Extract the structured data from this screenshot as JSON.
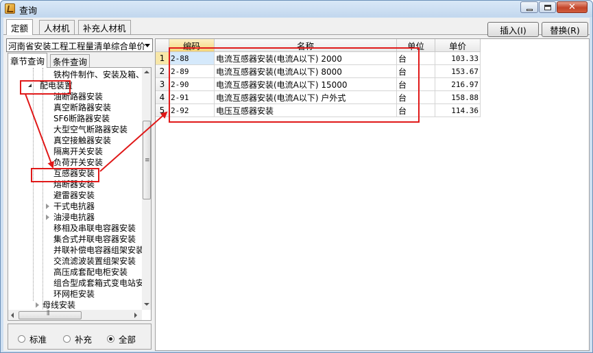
{
  "window": {
    "title": "查询"
  },
  "tabs": [
    {
      "label": "定额"
    },
    {
      "label": "人材机"
    },
    {
      "label": "补充人材机"
    }
  ],
  "toolbar": {
    "insert_label": "插入(I)",
    "replace_label": "替换(R)"
  },
  "library_select": {
    "value": "河南省安装工程工程量清单综合单价"
  },
  "subtabs": [
    {
      "label": "章节查询"
    },
    {
      "label": "条件查询"
    }
  ],
  "tree": {
    "items": [
      {
        "label": "铁构件制作、安装及箱、"
      },
      {
        "label": "配电装置"
      },
      {
        "label": "油断路器安装"
      },
      {
        "label": "真空断路器安装"
      },
      {
        "label": "SF6断路器安装"
      },
      {
        "label": "大型空气断路器安装"
      },
      {
        "label": "真空接触器安装"
      },
      {
        "label": "隔离开关安装"
      },
      {
        "label": "负荷开关安装"
      },
      {
        "label": "互感器安装"
      },
      {
        "label": "熔断器安装"
      },
      {
        "label": "避雷器安装"
      },
      {
        "label": "干式电抗器"
      },
      {
        "label": "油浸电抗器"
      },
      {
        "label": "移相及串联电容器安装"
      },
      {
        "label": "集合式并联电容器安装"
      },
      {
        "label": "并联补偿电容器组架安装"
      },
      {
        "label": "交流滤波装置组架安装"
      },
      {
        "label": "高压成套配电柜安装"
      },
      {
        "label": "组合型成套箱式变电站安装"
      },
      {
        "label": "环网柜安装"
      },
      {
        "label": "母线安装"
      }
    ]
  },
  "filter": {
    "options": [
      {
        "label": "标准"
      },
      {
        "label": "补充"
      },
      {
        "label": "全部"
      }
    ],
    "selected": "全部"
  },
  "table": {
    "columns": [
      "编码",
      "名称",
      "单位",
      "单价"
    ],
    "rows": [
      {
        "n": "1",
        "code": "2-88",
        "name": "电流互感器安装(电流A以下) 2000",
        "unit": "台",
        "price": "103.33"
      },
      {
        "n": "2",
        "code": "2-89",
        "name": "电流互感器安装(电流A以下) 8000",
        "unit": "台",
        "price": "153.67"
      },
      {
        "n": "3",
        "code": "2-90",
        "name": "电流互感器安装(电流A以下) 15000",
        "unit": "台",
        "price": "216.97"
      },
      {
        "n": "4",
        "code": "2-91",
        "name": "电流互感器安装(电流A以下) 户外式",
        "unit": "台",
        "price": "158.88"
      },
      {
        "n": "5",
        "code": "2-92",
        "name": "电压互感器安装",
        "unit": "台",
        "price": "114.36"
      }
    ]
  },
  "annotation_color": "#e01818",
  "icons": [
    "app-icon",
    "minimize-icon",
    "maximize-icon",
    "close-icon",
    "dropdown-arrow-icon",
    "expand-arrow-icon",
    "scroll-grip-icon"
  ]
}
